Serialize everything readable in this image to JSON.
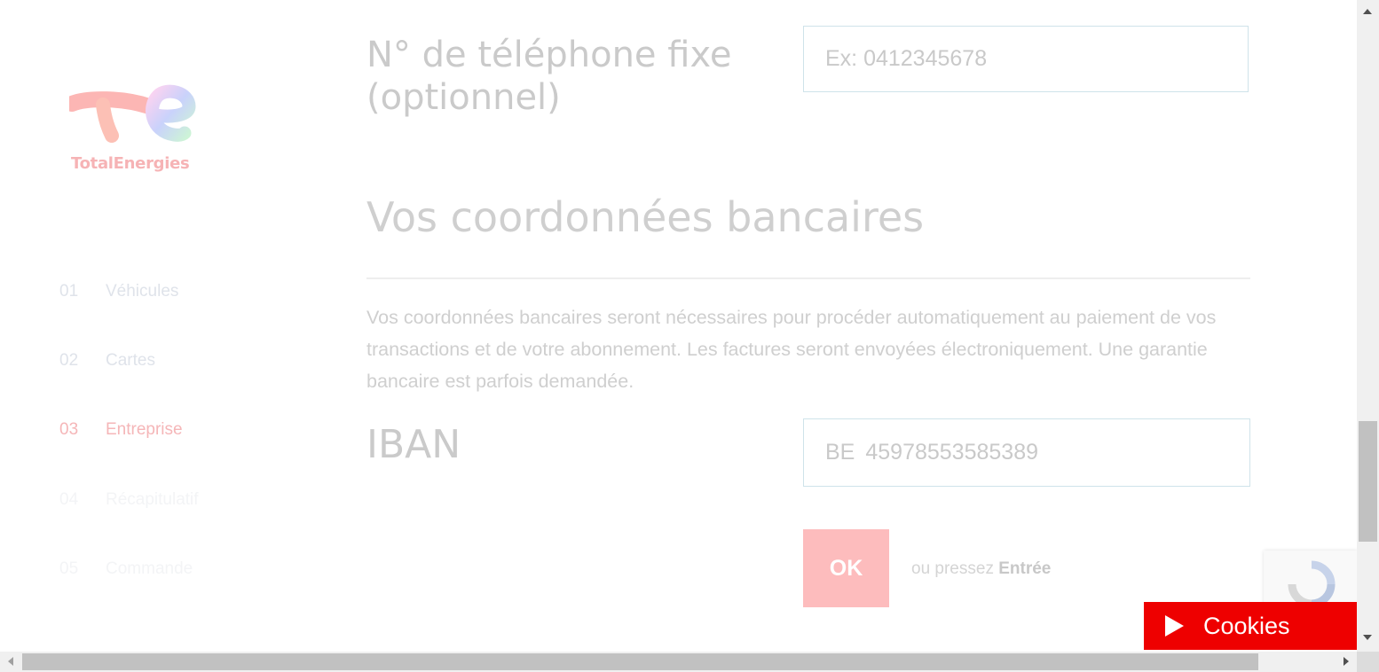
{
  "brand": {
    "name": "TotalEnergies"
  },
  "steps": [
    {
      "num": "01",
      "label": "Véhicules"
    },
    {
      "num": "02",
      "label": "Cartes"
    },
    {
      "num": "03",
      "label": "Entreprise"
    },
    {
      "num": "04",
      "label": "Récapitulatif"
    },
    {
      "num": "05",
      "label": "Commande"
    }
  ],
  "phone": {
    "label": "N° de téléphone fixe (optionnel)",
    "placeholder": "Ex: 0412345678"
  },
  "bank": {
    "title": "Vos coordonnées bancaires",
    "description": "Vos coordonnées bancaires seront nécessaires pour procéder automatiquement au paiement de vos transactions et de votre abonnement. Les factures seront envoyées électroniquement. Une garantie bancaire est parfois demandée.",
    "iban_label": "IBAN",
    "iban_prefix": "BE",
    "iban_value": "45978553585389"
  },
  "submit": {
    "ok_label": "OK",
    "hint_prefix": "ou pressez",
    "hint_key": "Entrée"
  },
  "cookies": {
    "label": "Cookies"
  },
  "colors": {
    "accent": "#ee0000",
    "ok_button": "#fdbcbd",
    "active_step": "#f5b6b8"
  }
}
